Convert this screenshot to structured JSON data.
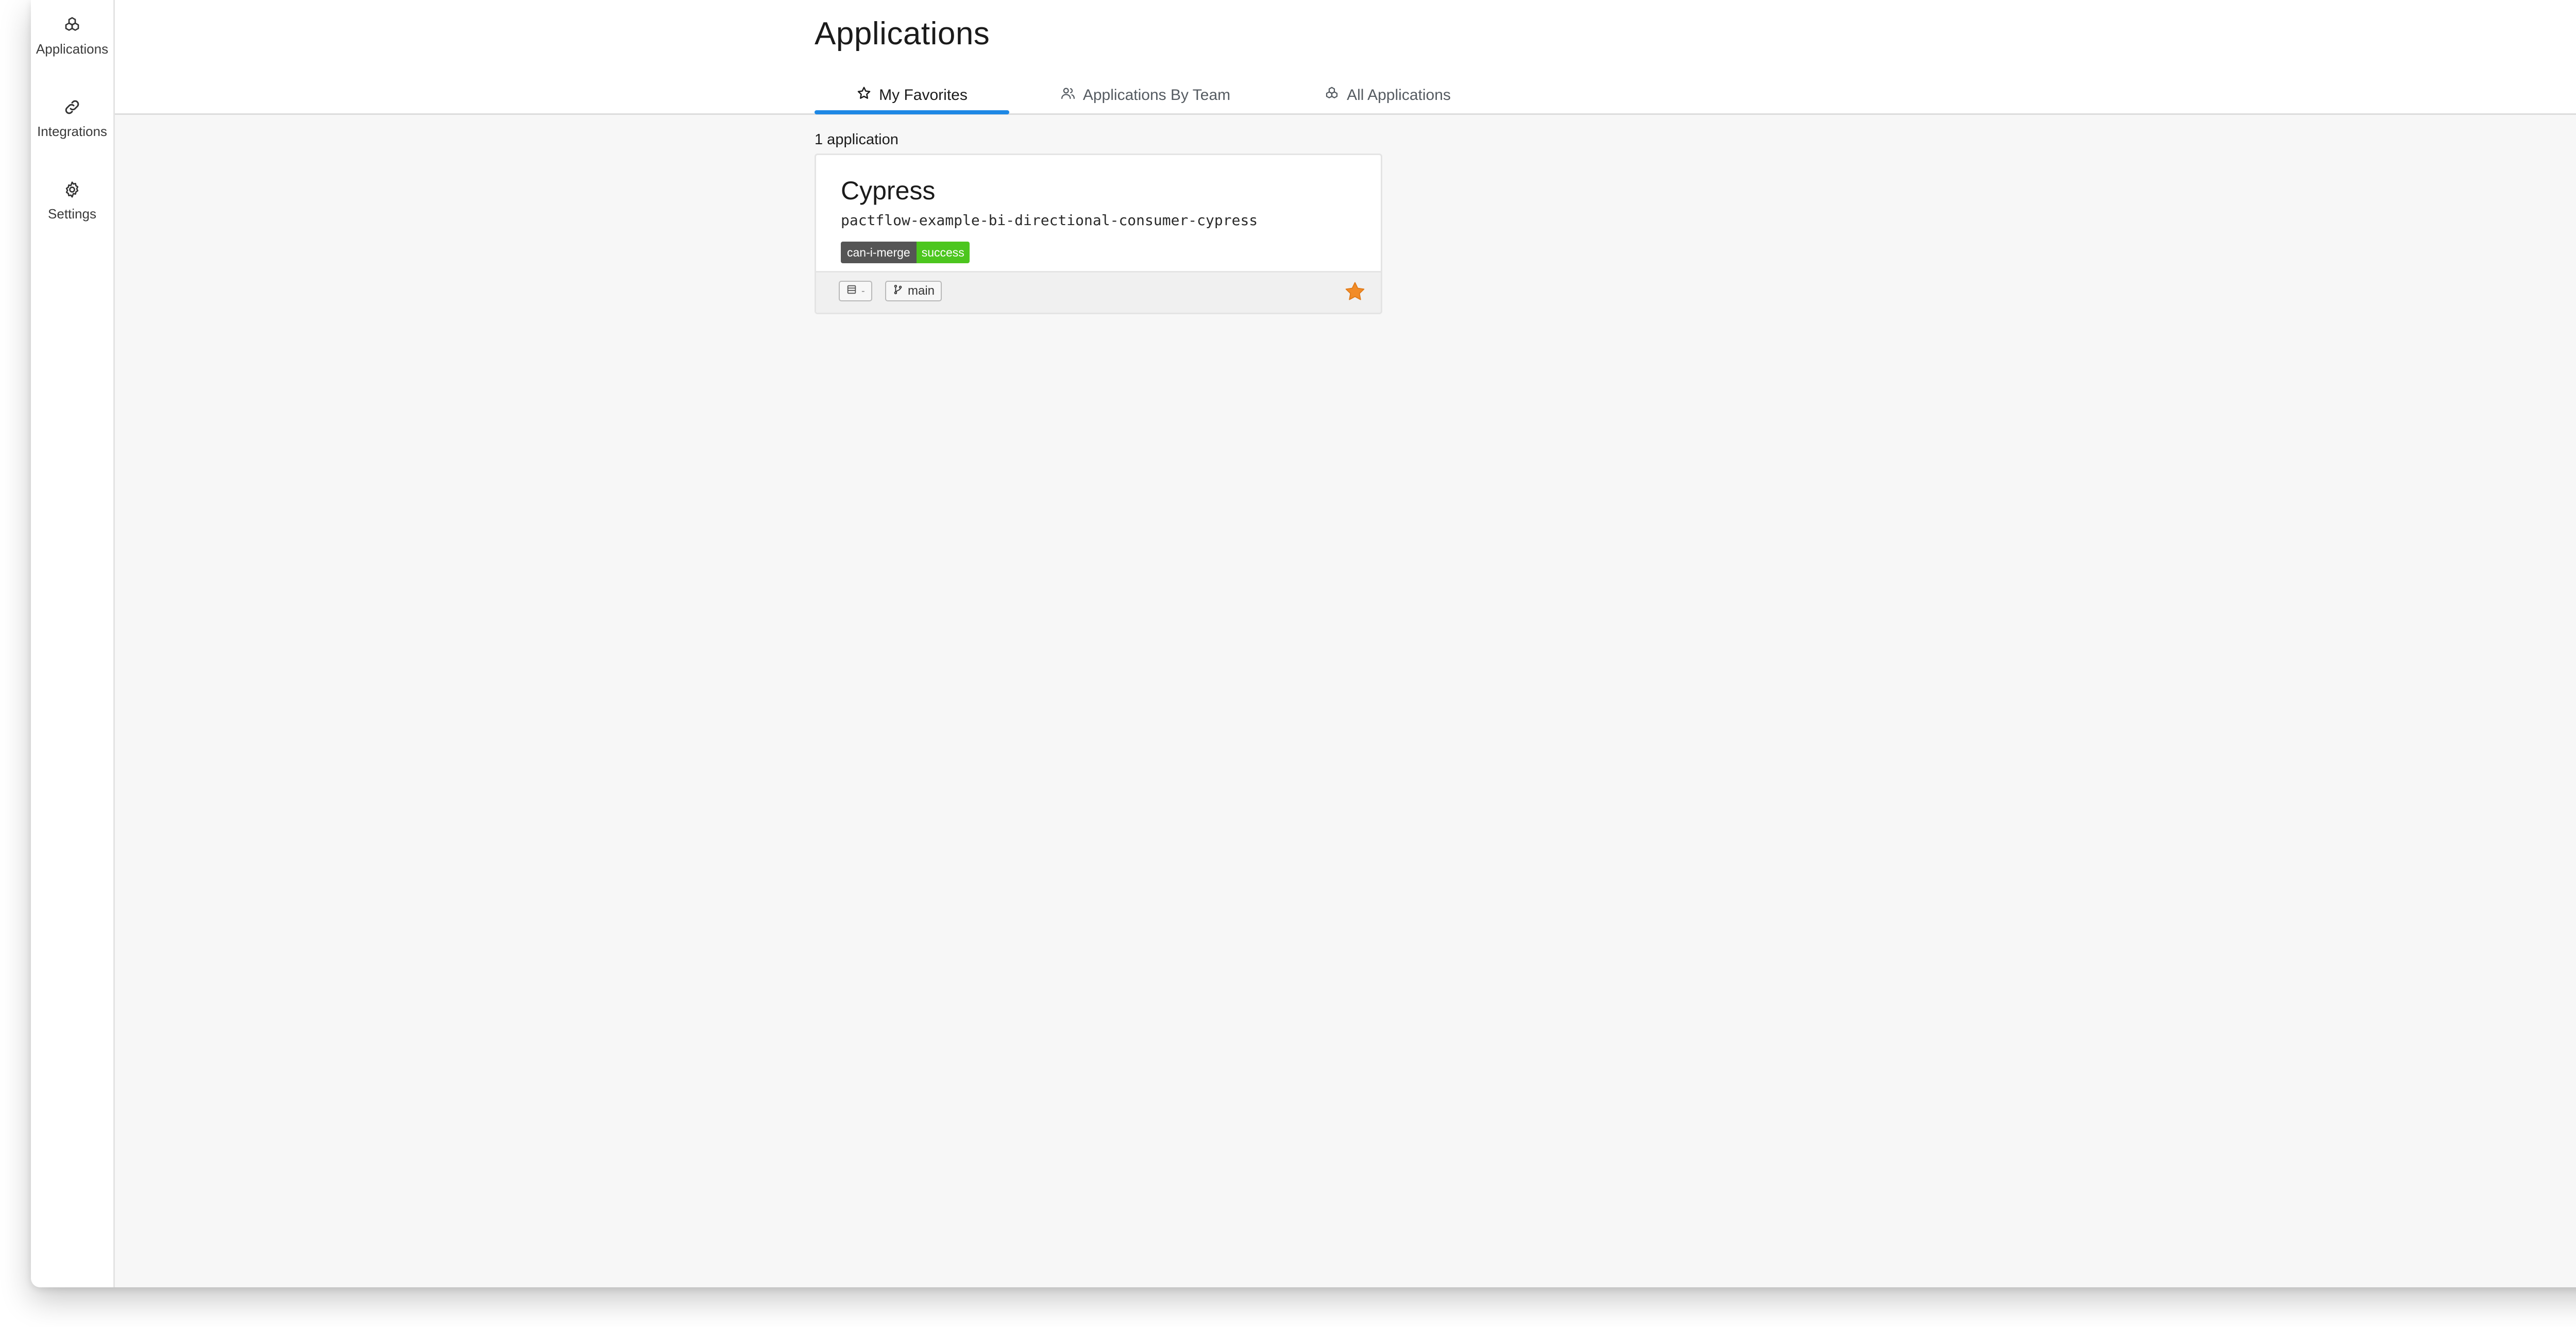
{
  "sidebar": {
    "items": [
      {
        "label": "Applications",
        "icon": "applications-icon"
      },
      {
        "label": "Integrations",
        "icon": "link-icon"
      },
      {
        "label": "Settings",
        "icon": "gear-icon"
      }
    ]
  },
  "header": {
    "title": "Applications",
    "tabs": [
      {
        "label": "My Favorites",
        "icon": "star-outline-icon",
        "active": true
      },
      {
        "label": "Applications By Team",
        "icon": "team-icon",
        "active": false
      },
      {
        "label": "All Applications",
        "icon": "applications-icon",
        "active": false
      }
    ]
  },
  "main": {
    "count_text": "1 application",
    "cards": [
      {
        "name": "Cypress",
        "slug": "pactflow-example-bi-directional-consumer-cypress",
        "badge": {
          "left": "can-i-merge",
          "right": "success"
        },
        "environment_chip": {
          "icon": "environment-icon",
          "text": "-"
        },
        "branch_chip": {
          "icon": "git-branch-icon",
          "text": "main"
        },
        "favorite": true
      }
    ]
  },
  "colors": {
    "accent": "#1e88e5",
    "badge_label_bg": "#555555",
    "badge_success_bg": "#4cc61e",
    "favorite_star": "#f28c28"
  }
}
